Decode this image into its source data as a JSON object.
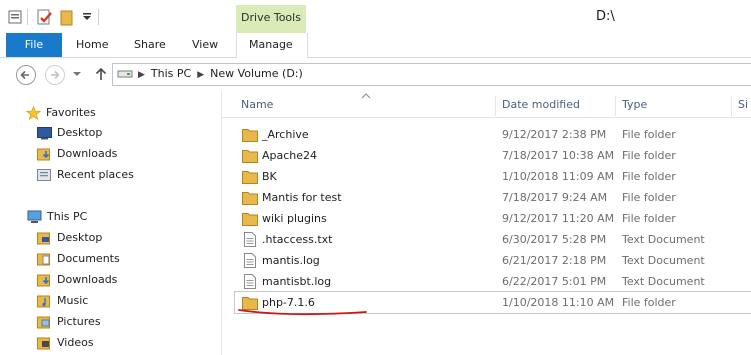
{
  "window": {
    "title": "D:\\",
    "context_tab": "Drive Tools"
  },
  "ribbon": {
    "tabs": [
      {
        "label": "File"
      },
      {
        "label": "Home"
      },
      {
        "label": "Share"
      },
      {
        "label": "View"
      },
      {
        "label": "Manage"
      }
    ]
  },
  "address": {
    "crumbs": [
      "This PC",
      "New Volume (D:)"
    ]
  },
  "navpane": {
    "favorites_label": "Favorites",
    "favorites": [
      {
        "label": "Desktop"
      },
      {
        "label": "Downloads"
      },
      {
        "label": "Recent places"
      }
    ],
    "thispc_label": "This PC",
    "thispc": [
      {
        "label": "Desktop"
      },
      {
        "label": "Documents"
      },
      {
        "label": "Downloads"
      },
      {
        "label": "Music"
      },
      {
        "label": "Pictures"
      },
      {
        "label": "Videos"
      }
    ]
  },
  "columns": {
    "name": "Name",
    "date": "Date modified",
    "type": "Type",
    "size": "Si"
  },
  "files": [
    {
      "name": "_Archive",
      "date": "9/12/2017 2:38 PM",
      "type": "File folder",
      "icon": "folder-icon"
    },
    {
      "name": "Apache24",
      "date": "7/18/2017 10:38 AM",
      "type": "File folder",
      "icon": "folder-icon"
    },
    {
      "name": "BK",
      "date": "1/10/2018 11:09 AM",
      "type": "File folder",
      "icon": "folder-icon"
    },
    {
      "name": "Mantis for test",
      "date": "7/18/2017 9:24 AM",
      "type": "File folder",
      "icon": "folder-icon"
    },
    {
      "name": "wiki plugins",
      "date": "9/12/2017 11:20 AM",
      "type": "File folder",
      "icon": "folder-icon"
    },
    {
      "name": ".htaccess.txt",
      "date": "6/30/2017 5:28 PM",
      "type": "Text Document",
      "icon": "text-document-icon"
    },
    {
      "name": "mantis.log",
      "date": "6/21/2017 2:18 PM",
      "type": "Text Document",
      "icon": "text-document-icon"
    },
    {
      "name": "mantisbt.log",
      "date": "6/22/2017 5:01 PM",
      "type": "Text Document",
      "icon": "text-document-icon"
    },
    {
      "name": "php-7.1.6",
      "date": "1/10/2018 11:10 AM",
      "type": "File folder",
      "icon": "folder-icon"
    }
  ],
  "colors": {
    "file_tab": "#1979ca",
    "drive_tools": "#d9ecb8",
    "folder": "#e8b84a",
    "annotation": "#d21414"
  }
}
